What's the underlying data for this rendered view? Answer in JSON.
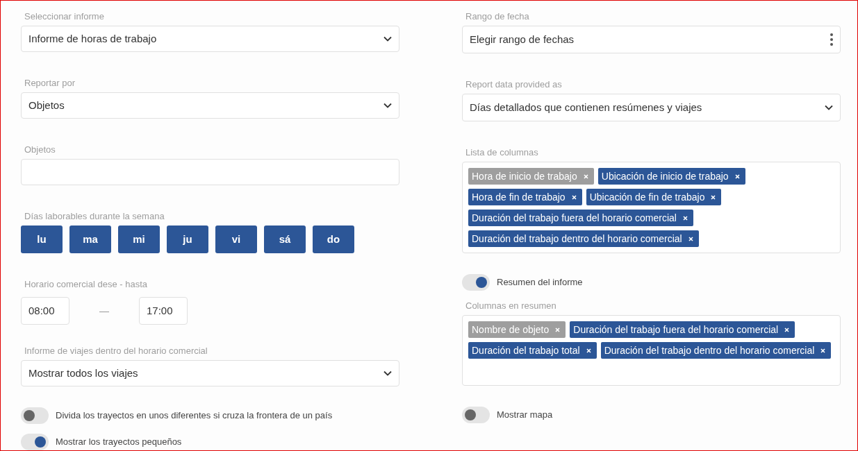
{
  "left": {
    "report_select": {
      "label": "Seleccionar informe",
      "value": "Informe de horas de trabajo"
    },
    "report_by": {
      "label": "Reportar por",
      "value": "Objetos"
    },
    "objects": {
      "label": "Objetos"
    },
    "workdays": {
      "label": "Días laborables durante la semana",
      "days": [
        {
          "label": "lu",
          "selected": true
        },
        {
          "label": "ma",
          "selected": true
        },
        {
          "label": "mi",
          "selected": true
        },
        {
          "label": "ju",
          "selected": true
        },
        {
          "label": "vi",
          "selected": true
        },
        {
          "label": "sá",
          "selected": true
        },
        {
          "label": "do",
          "selected": true
        }
      ]
    },
    "business_hours": {
      "label": "Horario comercial dese - hasta",
      "from": "08:00",
      "separator": "—",
      "to": "17:00"
    },
    "trips_report": {
      "label": "Informe de viajes dentro del horario comercial",
      "value": "Mostrar todos los viajes"
    },
    "toggles": [
      {
        "label": "Divida los trayectos en unos diferentes si cruza la frontera de un país",
        "on": false
      },
      {
        "label": "Mostrar los trayectos pequeños",
        "on": true
      }
    ]
  },
  "right": {
    "date_range": {
      "label": "Rango de fecha",
      "value": "Elegir rango de fechas"
    },
    "data_provided_as": {
      "label": "Report data provided as",
      "value": "Días detallados que contienen resúmenes y viajes"
    },
    "columns": {
      "label": "Lista de columnas",
      "tags": [
        {
          "label": "Hora de inicio de trabajo",
          "locked": true
        },
        {
          "label": "Ubicación de inicio de trabajo",
          "locked": false
        },
        {
          "label": "Hora de fin de trabajo",
          "locked": false
        },
        {
          "label": "Ubicación de fin de trabajo",
          "locked": false
        },
        {
          "label": "Duración del trabajo fuera del horario comercial",
          "locked": false
        },
        {
          "label": "Duración del trabajo dentro del horario comercial",
          "locked": false
        }
      ]
    },
    "summary_toggle": {
      "label": "Resumen del informe",
      "on": true
    },
    "summary_columns": {
      "label": "Columnas en resumen",
      "tags": [
        {
          "label": "Nombre de objeto",
          "locked": true
        },
        {
          "label": "Duración del trabajo fuera del horario comercial",
          "locked": false
        },
        {
          "label": "Duración del trabajo total",
          "locked": false
        },
        {
          "label": "Duración del trabajo dentro del horario comercial",
          "locked": false
        }
      ]
    },
    "map_toggle": {
      "label": "Mostrar mapa",
      "on": false
    }
  }
}
